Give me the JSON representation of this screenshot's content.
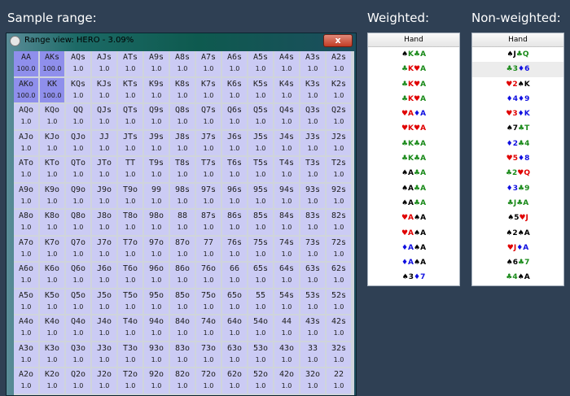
{
  "headings": {
    "sample": "Sample range:",
    "weighted": "Weighted:",
    "nonweighted": "Non-weighted:"
  },
  "window": {
    "title": "Range view: HERO - 3.09%",
    "close_glyph": "x"
  },
  "colors": {
    "background": "#2f4054",
    "cell": "#cbcbf4",
    "cell_selected": "#8f8fec",
    "close": "#c23c24"
  },
  "grid": [
    [
      "AA",
      "AKs",
      "AQs",
      "AJs",
      "ATs",
      "A9s",
      "A8s",
      "A7s",
      "A6s",
      "A5s",
      "A4s",
      "A3s",
      "A2s"
    ],
    [
      "AKo",
      "KK",
      "KQs",
      "KJs",
      "KTs",
      "K9s",
      "K8s",
      "K7s",
      "K6s",
      "K5s",
      "K4s",
      "K3s",
      "K2s"
    ],
    [
      "AQo",
      "KQo",
      "QQ",
      "QJs",
      "QTs",
      "Q9s",
      "Q8s",
      "Q7s",
      "Q6s",
      "Q5s",
      "Q4s",
      "Q3s",
      "Q2s"
    ],
    [
      "AJo",
      "KJo",
      "QJo",
      "JJ",
      "JTs",
      "J9s",
      "J8s",
      "J7s",
      "J6s",
      "J5s",
      "J4s",
      "J3s",
      "J2s"
    ],
    [
      "ATo",
      "KTo",
      "QTo",
      "JTo",
      "TT",
      "T9s",
      "T8s",
      "T7s",
      "T6s",
      "T5s",
      "T4s",
      "T3s",
      "T2s"
    ],
    [
      "A9o",
      "K9o",
      "Q9o",
      "J9o",
      "T9o",
      "99",
      "98s",
      "97s",
      "96s",
      "95s",
      "94s",
      "93s",
      "92s"
    ],
    [
      "A8o",
      "K8o",
      "Q8o",
      "J8o",
      "T8o",
      "98o",
      "88",
      "87s",
      "86s",
      "85s",
      "84s",
      "83s",
      "82s"
    ],
    [
      "A7o",
      "K7o",
      "Q7o",
      "J7o",
      "T7o",
      "97o",
      "87o",
      "77",
      "76s",
      "75s",
      "74s",
      "73s",
      "72s"
    ],
    [
      "A6o",
      "K6o",
      "Q6o",
      "J6o",
      "T6o",
      "96o",
      "86o",
      "76o",
      "66",
      "65s",
      "64s",
      "63s",
      "62s"
    ],
    [
      "A5o",
      "K5o",
      "Q5o",
      "J5o",
      "T5o",
      "95o",
      "85o",
      "75o",
      "65o",
      "55",
      "54s",
      "53s",
      "52s"
    ],
    [
      "A4o",
      "K4o",
      "Q4o",
      "J4o",
      "T4o",
      "94o",
      "84o",
      "74o",
      "64o",
      "54o",
      "44",
      "43s",
      "42s"
    ],
    [
      "A3o",
      "K3o",
      "Q3o",
      "J3o",
      "T3o",
      "93o",
      "83o",
      "73o",
      "63o",
      "53o",
      "43o",
      "33",
      "32s"
    ],
    [
      "A2o",
      "K2o",
      "Q2o",
      "J2o",
      "T2o",
      "92o",
      "82o",
      "72o",
      "62o",
      "52o",
      "42o",
      "32o",
      "22"
    ]
  ],
  "default_value": "1.0",
  "selected": [
    {
      "hand": "AA",
      "value": "100.0"
    },
    {
      "hand": "AKs",
      "value": "100.0"
    },
    {
      "hand": "AKo",
      "value": "100.0"
    },
    {
      "hand": "KK",
      "value": "100.0"
    }
  ],
  "weighted": {
    "header": "Hand",
    "rows": [
      [
        [
          "♠",
          "s"
        ],
        [
          "K",
          "c"
        ],
        [
          "♣",
          "c"
        ],
        [
          "A",
          "c"
        ]
      ],
      [
        [
          "♣",
          "c"
        ],
        [
          "K",
          "h"
        ],
        [
          "♥",
          "h"
        ],
        [
          "A",
          "c"
        ]
      ],
      [
        [
          "♣",
          "c"
        ],
        [
          "K",
          "h"
        ],
        [
          "♥",
          "h"
        ],
        [
          "A",
          "c"
        ]
      ],
      [
        [
          "♣",
          "c"
        ],
        [
          "K",
          "h"
        ],
        [
          "♥",
          "h"
        ],
        [
          "A",
          "c"
        ]
      ],
      [
        [
          "♥",
          "h"
        ],
        [
          "A",
          "h"
        ],
        [
          "♦",
          "d"
        ],
        [
          "A",
          "d"
        ]
      ],
      [
        [
          "♥",
          "h"
        ],
        [
          "K",
          "h"
        ],
        [
          "♥",
          "h"
        ],
        [
          "A",
          "h"
        ]
      ],
      [
        [
          "♣",
          "c"
        ],
        [
          "K",
          "c"
        ],
        [
          "♣",
          "c"
        ],
        [
          "A",
          "c"
        ]
      ],
      [
        [
          "♣",
          "c"
        ],
        [
          "K",
          "c"
        ],
        [
          "♣",
          "c"
        ],
        [
          "A",
          "c"
        ]
      ],
      [
        [
          "♠",
          "s"
        ],
        [
          "A",
          "s"
        ],
        [
          "♣",
          "c"
        ],
        [
          "A",
          "c"
        ]
      ],
      [
        [
          "♠",
          "s"
        ],
        [
          "A",
          "s"
        ],
        [
          "♣",
          "c"
        ],
        [
          "A",
          "c"
        ]
      ],
      [
        [
          "♠",
          "s"
        ],
        [
          "A",
          "s"
        ],
        [
          "♣",
          "c"
        ],
        [
          "A",
          "c"
        ]
      ],
      [
        [
          "♥",
          "h"
        ],
        [
          "A",
          "h"
        ],
        [
          "♠",
          "s"
        ],
        [
          "A",
          "s"
        ]
      ],
      [
        [
          "♥",
          "h"
        ],
        [
          "A",
          "h"
        ],
        [
          "♠",
          "s"
        ],
        [
          "A",
          "s"
        ]
      ],
      [
        [
          "♦",
          "d"
        ],
        [
          "A",
          "d"
        ],
        [
          "♠",
          "s"
        ],
        [
          "A",
          "s"
        ]
      ],
      [
        [
          "♦",
          "d"
        ],
        [
          "A",
          "d"
        ],
        [
          "♠",
          "s"
        ],
        [
          "A",
          "s"
        ]
      ],
      [
        [
          "♠",
          "s"
        ],
        [
          "3",
          "s"
        ],
        [
          "♦",
          "d"
        ],
        [
          "7",
          "d"
        ]
      ]
    ]
  },
  "nonweighted": {
    "header": "Hand",
    "highlight_row": 1,
    "rows": [
      [
        [
          "♠",
          "s"
        ],
        [
          "J",
          "s"
        ],
        [
          "♣",
          "c"
        ],
        [
          "Q",
          "c"
        ]
      ],
      [
        [
          "♣",
          "c"
        ],
        [
          "3",
          "c"
        ],
        [
          "♦",
          "d"
        ],
        [
          "6",
          "d"
        ]
      ],
      [
        [
          "♥",
          "h"
        ],
        [
          "2",
          "h"
        ],
        [
          "♠",
          "s"
        ],
        [
          "K",
          "s"
        ]
      ],
      [
        [
          "♦",
          "d"
        ],
        [
          "4",
          "d"
        ],
        [
          "♦",
          "d"
        ],
        [
          "9",
          "d"
        ]
      ],
      [
        [
          "♥",
          "h"
        ],
        [
          "3",
          "h"
        ],
        [
          "♦",
          "d"
        ],
        [
          "K",
          "d"
        ]
      ],
      [
        [
          "♠",
          "s"
        ],
        [
          "7",
          "s"
        ],
        [
          "♣",
          "c"
        ],
        [
          "T",
          "c"
        ]
      ],
      [
        [
          "♦",
          "d"
        ],
        [
          "2",
          "d"
        ],
        [
          "♣",
          "c"
        ],
        [
          "4",
          "c"
        ]
      ],
      [
        [
          "♥",
          "h"
        ],
        [
          "5",
          "h"
        ],
        [
          "♦",
          "d"
        ],
        [
          "8",
          "d"
        ]
      ],
      [
        [
          "♣",
          "c"
        ],
        [
          "2",
          "c"
        ],
        [
          "♥",
          "h"
        ],
        [
          "Q",
          "h"
        ]
      ],
      [
        [
          "♦",
          "d"
        ],
        [
          "3",
          "d"
        ],
        [
          "♣",
          "c"
        ],
        [
          "9",
          "c"
        ]
      ],
      [
        [
          "♣",
          "c"
        ],
        [
          "J",
          "c"
        ],
        [
          "♣",
          "c"
        ],
        [
          "A",
          "c"
        ]
      ],
      [
        [
          "♠",
          "s"
        ],
        [
          "5",
          "s"
        ],
        [
          "♥",
          "h"
        ],
        [
          "J",
          "h"
        ]
      ],
      [
        [
          "♠",
          "s"
        ],
        [
          "2",
          "s"
        ],
        [
          "♠",
          "s"
        ],
        [
          "A",
          "s"
        ]
      ],
      [
        [
          "♥",
          "h"
        ],
        [
          "J",
          "h"
        ],
        [
          "♦",
          "d"
        ],
        [
          "A",
          "d"
        ]
      ],
      [
        [
          "♠",
          "s"
        ],
        [
          "6",
          "s"
        ],
        [
          "♣",
          "c"
        ],
        [
          "7",
          "c"
        ]
      ],
      [
        [
          "♣",
          "c"
        ],
        [
          "4",
          "c"
        ],
        [
          "♠",
          "s"
        ],
        [
          "A",
          "s"
        ]
      ]
    ]
  }
}
